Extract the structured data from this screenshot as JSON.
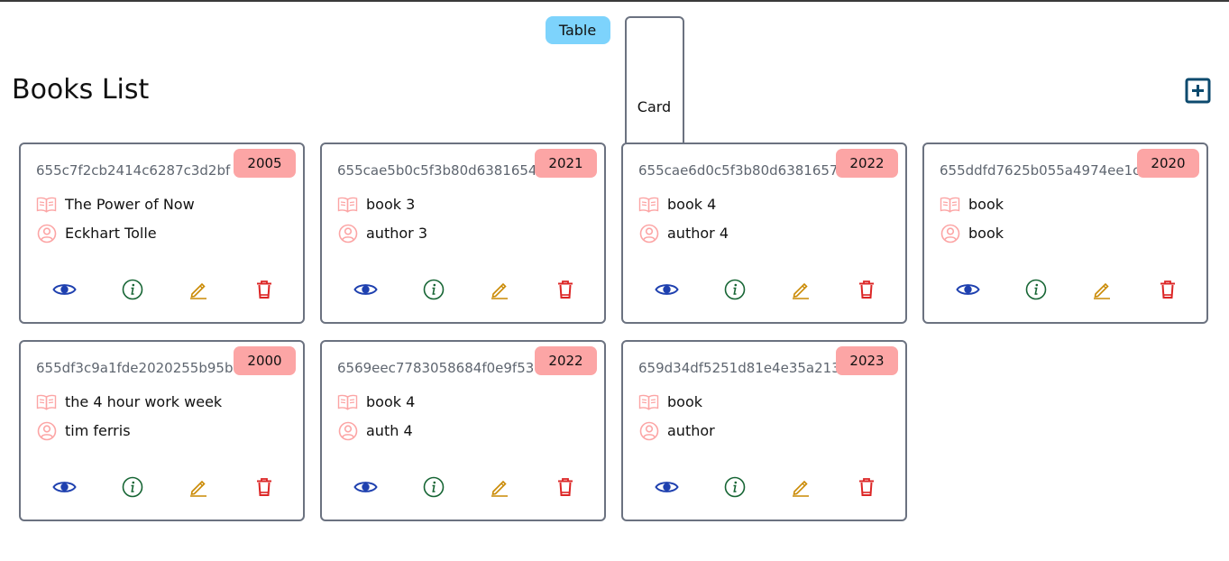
{
  "view_toggle": {
    "table_label": "Table",
    "card_label": "Card"
  },
  "page": {
    "title": "Books List",
    "add_icon": "plus-square-icon"
  },
  "colors": {
    "toggle_bg": "#7dd3fc",
    "badge_bg": "#fca5a5",
    "view_icon": "#1e40af",
    "info_icon": "#166534",
    "edit_icon": "#ca8a04",
    "delete_icon": "#dc2626",
    "add_icon": "#0c4a6e"
  },
  "books": [
    {
      "id": "655c7f2cb2414c6287c3d2bf",
      "year": "2005",
      "title": "The Power of Now",
      "author": "Eckhart Tolle"
    },
    {
      "id": "655cae5b0c5f3b80d6381654",
      "year": "2021",
      "title": "book 3",
      "author": "author 3"
    },
    {
      "id": "655cae6d0c5f3b80d6381657",
      "year": "2022",
      "title": "book 4",
      "author": "author 4"
    },
    {
      "id": "655ddfd7625b055a4974ee1c",
      "year": "2020",
      "title": "book",
      "author": "book"
    },
    {
      "id": "655df3c9a1fde2020255b95b",
      "year": "2000",
      "title": "the 4 hour work week",
      "author": "tim ferris"
    },
    {
      "id": "6569eec7783058684f0e9f53",
      "year": "2022",
      "title": "book 4",
      "author": "auth 4"
    },
    {
      "id": "659d34df5251d81e4e35a213",
      "year": "2023",
      "title": "book",
      "author": "author"
    }
  ]
}
